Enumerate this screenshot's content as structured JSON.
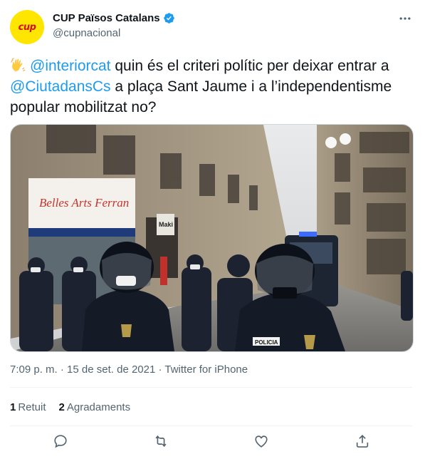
{
  "account": {
    "name": "CUP Països Catalans",
    "handle": "@cupnacional",
    "avatar_text": "cup",
    "brand_color": "#ffe600",
    "verified_color": "#1d9bf0"
  },
  "tweet": {
    "emoji": "waving-hand-icon",
    "mention_1": "@interiorcat",
    "text_1": " quin és el criteri polític per deixar entrar a ",
    "mention_2": "@CiutadansCs",
    "text_2": " a plaça Sant Jaume i a l’independentisme popular mobilitzat no?",
    "mention_color": "#1d9bf0"
  },
  "media": {
    "shop_sign": "Belles Arts Ferran",
    "store_sign_2": "Maki",
    "police_label": "POLICIA"
  },
  "meta": {
    "time": "7:09 p. m.",
    "separator": " · ",
    "date": "15 de set. de 2021",
    "client": "Twitter for iPhone"
  },
  "stats": {
    "retweets_count": "1",
    "retweets_label": "Retuit",
    "likes_count": "2",
    "likes_label": "Agradaments"
  }
}
